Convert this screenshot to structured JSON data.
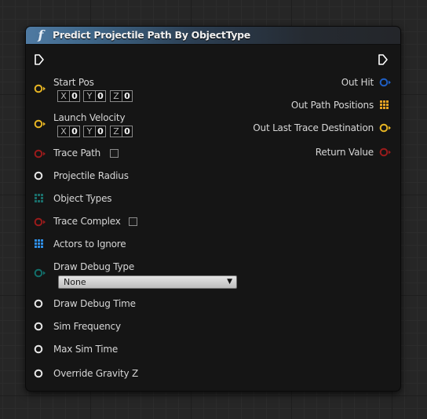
{
  "node": {
    "title": "Predict Projectile Path By ObjectType",
    "icon": "function-icon",
    "header_color": "#3e6587"
  },
  "colors": {
    "vector": "#e6b423",
    "boolean": "#9a1b1b",
    "float": "#e8e8e8",
    "object_ref": "#2e8f8a",
    "actor_array": "#2f8ee6",
    "byte_enum": "#126e6a",
    "vector_array": "#e6a323",
    "exec": "#ffffff"
  },
  "inputs": {
    "start_pos": {
      "label": "Start Pos",
      "x_axis": "X",
      "x": "0",
      "y_axis": "Y",
      "y": "0",
      "z_axis": "Z",
      "z": "0"
    },
    "launch_velocity": {
      "label": "Launch Velocity",
      "x_axis": "X",
      "x": "0",
      "y_axis": "Y",
      "y": "0",
      "z_axis": "Z",
      "z": "0"
    },
    "trace_path": {
      "label": "Trace Path",
      "checked": false
    },
    "projectile_radius": {
      "label": "Projectile Radius"
    },
    "object_types": {
      "label": "Object Types"
    },
    "trace_complex": {
      "label": "Trace Complex",
      "checked": false
    },
    "actors_to_ignore": {
      "label": "Actors to Ignore"
    },
    "draw_debug_type": {
      "label": "Draw Debug Type",
      "selected": "None"
    },
    "draw_debug_time": {
      "label": "Draw Debug Time"
    },
    "sim_frequency": {
      "label": "Sim Frequency"
    },
    "max_sim_time": {
      "label": "Max Sim Time"
    },
    "override_gravity_z": {
      "label": "Override Gravity Z"
    }
  },
  "outputs": {
    "out_hit": {
      "label": "Out Hit"
    },
    "out_path_positions": {
      "label": "Out Path Positions"
    },
    "out_last_trace_destination": {
      "label": "Out Last Trace Destination"
    },
    "return_value": {
      "label": "Return Value"
    }
  }
}
